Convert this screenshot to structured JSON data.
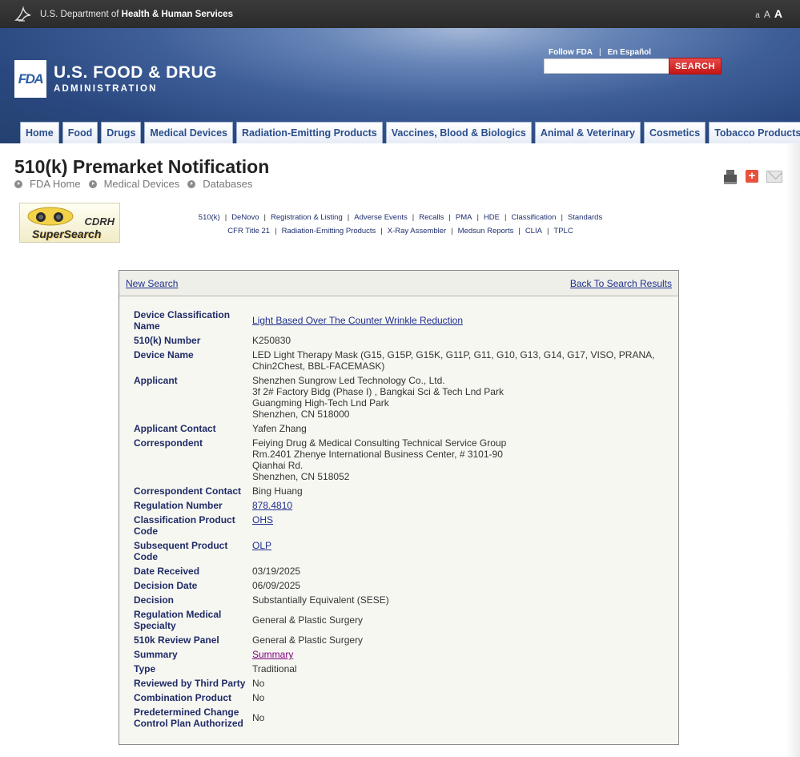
{
  "hhs": {
    "prefix": "U.S. Department of",
    "bold": "Health & Human Services",
    "text_sizes": [
      "a",
      "A",
      "A"
    ]
  },
  "banner": {
    "logo": "FDA",
    "title": "U.S. FOOD & DRUG",
    "subtitle": "ADMINISTRATION",
    "follow": "Follow FDA",
    "espanol": "En Español",
    "search_placeholder": "",
    "search_button": "SEARCH"
  },
  "nav": {
    "tabs": [
      "Home",
      "Food",
      "Drugs",
      "Medical Devices",
      "Radiation-Emitting Products",
      "Vaccines, Blood & Biologics",
      "Animal & Veterinary",
      "Cosmetics",
      "Tobacco Products"
    ]
  },
  "page": {
    "title": "510(k) Premarket Notification",
    "breadcrumbs": [
      "FDA Home",
      "Medical Devices",
      "Databases"
    ]
  },
  "supersearch": {
    "logo_text_1": "CDRH",
    "logo_text_2": "SuperSearch",
    "links_row1": [
      "510(k)",
      "DeNovo",
      "Registration & Listing",
      "Adverse Events",
      "Recalls",
      "PMA",
      "HDE",
      "Classification",
      "Standards"
    ],
    "links_row2": [
      "CFR Title 21",
      "Radiation-Emitting Products",
      "X-Ray Assembler",
      "Medsun Reports",
      "CLIA",
      "TPLC"
    ]
  },
  "result": {
    "new_search": "New Search",
    "back": "Back To Search Results",
    "rows": [
      {
        "label": "Device Classification Name",
        "value": "Light Based Over The Counter Wrinkle Reduction",
        "style": "link"
      },
      {
        "label": "510(k) Number",
        "value": "K250830"
      },
      {
        "label": "Device Name",
        "value": "LED Light Therapy Mask (G15, G15P, G15K, G11P, G11, G10, G13, G14, G17, VISO, PRANA, Chin2Chest, BBL-FACEMASK)"
      },
      {
        "label": "Applicant",
        "value": "Shenzhen Sungrow Led Technology Co., Ltd.\n3f 2# Factory Bidg (Phase I) , Bangkai Sci & Tech Lnd Park\nGuangming High-Tech Lnd Park\nShenzhen,  CN 518000"
      },
      {
        "label": "Applicant Contact",
        "value": "Yafen Zhang"
      },
      {
        "label": "Correspondent",
        "value": "Feiying Drug & Medical Consulting Technical Service Group\nRm.2401 Zhenye International Business Center, # 3101-90\nQianhai Rd.\nShenzhen,  CN 518052"
      },
      {
        "label": "Correspondent Contact",
        "value": "Bing Huang"
      },
      {
        "label": "Regulation Number",
        "value": "878.4810",
        "style": "link"
      },
      {
        "label": "Classification Product Code",
        "value": "OHS",
        "style": "link"
      },
      {
        "label": "Subsequent Product Code",
        "value": "OLP",
        "style": "link"
      },
      {
        "label": "Date Received",
        "value": "03/19/2025"
      },
      {
        "label": "Decision Date",
        "value": "06/09/2025"
      },
      {
        "label": "Decision",
        "value": "Substantially Equivalent (SESE)"
      },
      {
        "label": "Regulation Medical Specialty",
        "value": "General & Plastic Surgery",
        "style": "mid"
      },
      {
        "label": "510k Review Panel",
        "value": "General & Plastic Surgery"
      },
      {
        "label": "Summary",
        "value": "Summary",
        "style": "visited"
      },
      {
        "label": "Type",
        "value": "Traditional"
      },
      {
        "label": "Reviewed by Third Party",
        "value": "No"
      },
      {
        "label": "Combination Product",
        "value": "No"
      },
      {
        "label": "Predetermined Change Control Plan Authorized",
        "value": "No",
        "style": "mid"
      }
    ]
  }
}
